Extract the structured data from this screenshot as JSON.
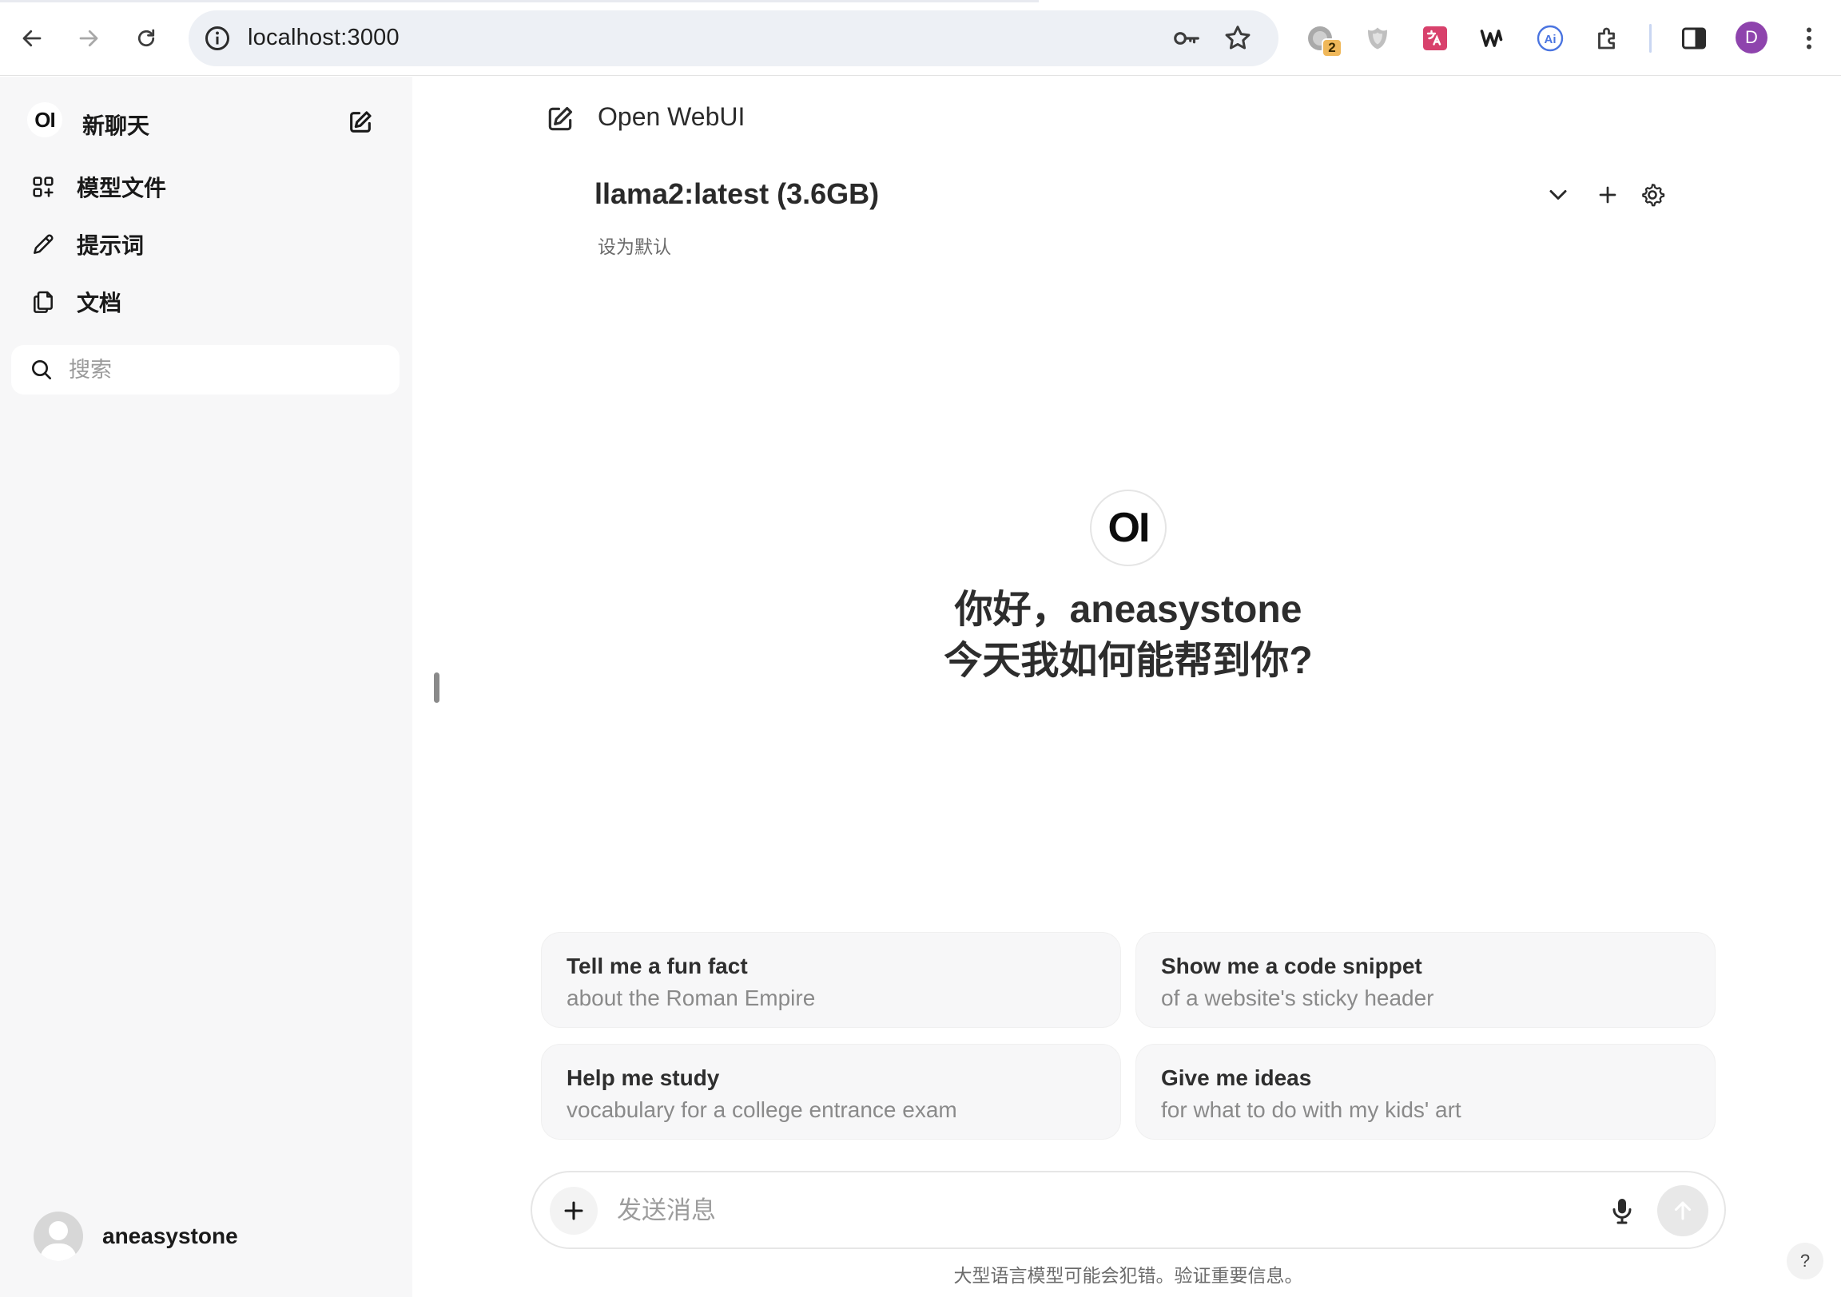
{
  "browser": {
    "url": "localhost:3000",
    "extension_badge_count": "2",
    "profile_initial": "D"
  },
  "sidebar": {
    "brand": "OI",
    "new_chat_label": "新聊天",
    "items": [
      {
        "label": "模型文件",
        "icon": "grid-plus-icon"
      },
      {
        "label": "提示词",
        "icon": "pencil-icon"
      },
      {
        "label": "文档",
        "icon": "documents-icon"
      }
    ],
    "search_placeholder": "搜索",
    "user_name": "aneasystone"
  },
  "main": {
    "title": "Open WebUI",
    "model_name": "llama2:latest (3.6GB)",
    "set_default_label": "设为默认",
    "hero_logo": "OI",
    "greeting_line1": "你好，aneasystone",
    "greeting_line2": "今天我如何能帮到你?",
    "suggestions": [
      {
        "title": "Tell me a fun fact",
        "subtitle": "about the Roman Empire"
      },
      {
        "title": "Show me a code snippet",
        "subtitle": "of a website's sticky header"
      },
      {
        "title": "Help me study",
        "subtitle": "vocabulary for a college entrance exam"
      },
      {
        "title": "Give me ideas",
        "subtitle": "for what to do with my kids' art"
      }
    ],
    "composer_placeholder": "发送消息",
    "disclaimer": "大型语言模型可能会犯错。验证重要信息。",
    "help_label": "?"
  },
  "colors": {
    "sidebar_bg": "#f7f7f8",
    "card_bg": "#f7f7f8",
    "profile": "#8e44ad",
    "badge": "#f0b85a"
  }
}
